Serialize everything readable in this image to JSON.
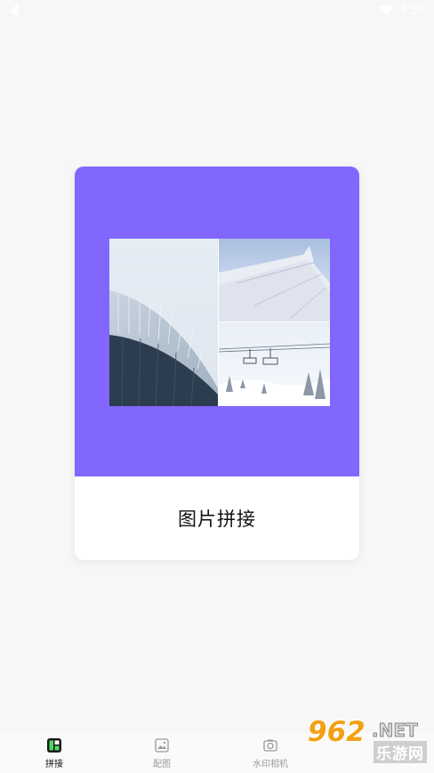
{
  "status_bar": {
    "time": "4:50"
  },
  "card": {
    "title": "图片拼接",
    "accent_color": "#8167fe"
  },
  "bottom_nav": {
    "items": [
      {
        "label": "拼接",
        "icon": "collage-icon",
        "active": true
      },
      {
        "label": "配图",
        "icon": "image-icon",
        "active": false
      },
      {
        "label": "水印相机",
        "icon": "camera-icon",
        "active": false
      }
    ]
  },
  "watermark": {
    "number": "962",
    "net": ".NET",
    "site": "乐游网"
  }
}
